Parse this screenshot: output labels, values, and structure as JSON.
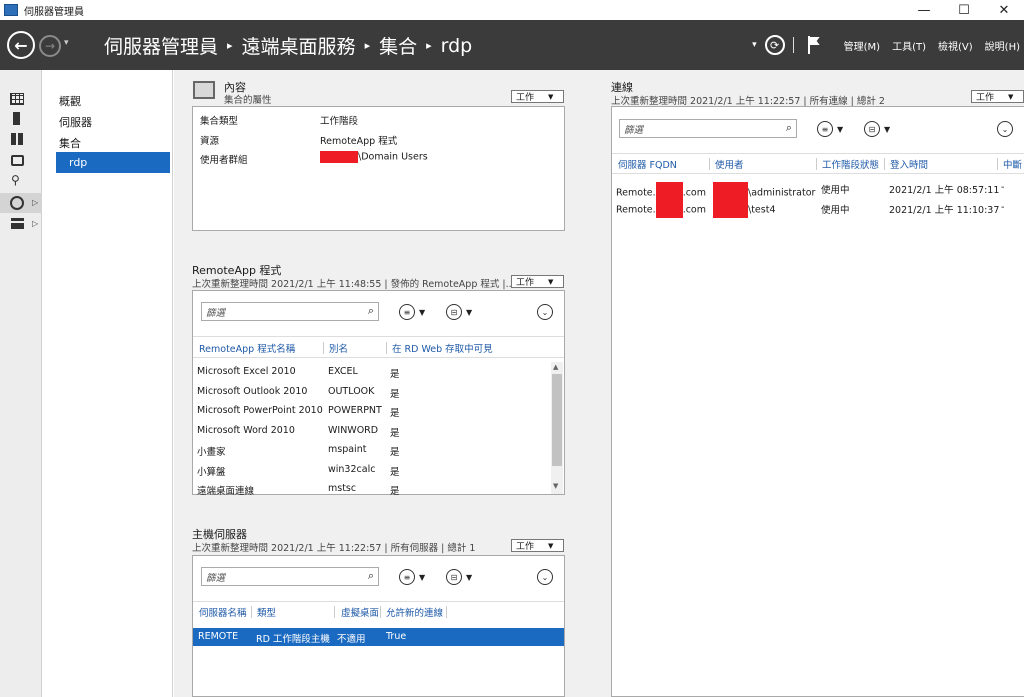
{
  "window": {
    "title": "伺服器管理員",
    "min": "—",
    "max": "☐",
    "close": "✕"
  },
  "nav": {
    "back": "←",
    "forward": "→",
    "dropdown": "▾",
    "breadcrumb": [
      "伺服器管理員",
      "遠端桌面服務",
      "集合",
      "rdp"
    ],
    "breadcrumb_sep": "▸",
    "refresh_drop": "▾",
    "menus": [
      "管理(M)",
      "工具(T)",
      "檢視(V)",
      "說明(H)"
    ]
  },
  "tree": {
    "items": [
      "概觀",
      "伺服器",
      "集合",
      "rdp"
    ]
  },
  "tasks_label": "工作",
  "properties": {
    "title": "內容",
    "subtitle": "集合的屬性",
    "rows": [
      {
        "label": "集合類型",
        "value": "工作階段"
      },
      {
        "label": "資源",
        "value": "RemoteApp 程式"
      },
      {
        "label": "使用者群組",
        "value": "\\Domain Users"
      }
    ]
  },
  "remoteapp": {
    "title": "RemoteApp 程式",
    "subtitle": "上次重新整理時間 2021/2/1 上午 11:48:55 | 發佈的 RemoteApp 程式 |...",
    "filter_placeholder": "篩選",
    "columns": [
      "RemoteApp 程式名稱",
      "別名",
      "在 RD Web 存取中可見"
    ],
    "rows": [
      [
        "Microsoft Excel 2010",
        "EXCEL",
        "是"
      ],
      [
        "Microsoft Outlook 2010",
        "OUTLOOK",
        "是"
      ],
      [
        "Microsoft PowerPoint 2010",
        "POWERPNT",
        "是"
      ],
      [
        "Microsoft Word 2010",
        "WINWORD",
        "是"
      ],
      [
        "小畫家",
        "mspaint",
        "是"
      ],
      [
        "小算盤",
        "win32calc",
        "是"
      ],
      [
        "遠端桌面連線",
        "mstsc",
        "是"
      ]
    ]
  },
  "hosts": {
    "title": "主機伺服器",
    "subtitle": "上次重新整理時間 2021/2/1 上午 11:22:57 | 所有伺服器 | 總計 1",
    "filter_placeholder": "篩選",
    "columns": [
      "伺服器名稱",
      "類型",
      "虛擬桌面",
      "允許新的連線"
    ],
    "rows": [
      [
        "REMOTE",
        "RD 工作階段主機",
        "不適用",
        "True"
      ]
    ]
  },
  "connections": {
    "title": "連線",
    "subtitle": "上次重新整理時間 2021/2/1 上午 11:22:57 | 所有連線 | 總計 2",
    "filter_placeholder": "篩選",
    "columns": [
      "伺服器 FQDN",
      "使用者",
      "工作階段狀態",
      "登入時間",
      "中斷"
    ],
    "rows": [
      {
        "fqdn_pre": "Remote.",
        "fqdn_post": ".com",
        "user": "\\administrator",
        "state": "使用中",
        "login": "2021/2/1 上午 08:57:11",
        "disc": "-"
      },
      {
        "fqdn_pre": "Remote.",
        "fqdn_post": ".com",
        "user": "\\test4",
        "state": "使用中",
        "login": "2021/2/1 上午 11:10:37",
        "disc": "-"
      }
    ]
  },
  "colors": {
    "accent": "#1b6ac1",
    "redaction": "#ee1c25",
    "navbar": "#3b3b3b"
  },
  "icons": {
    "search": "⌕",
    "list": "≡",
    "save": "⊟",
    "expand": "⌄"
  }
}
